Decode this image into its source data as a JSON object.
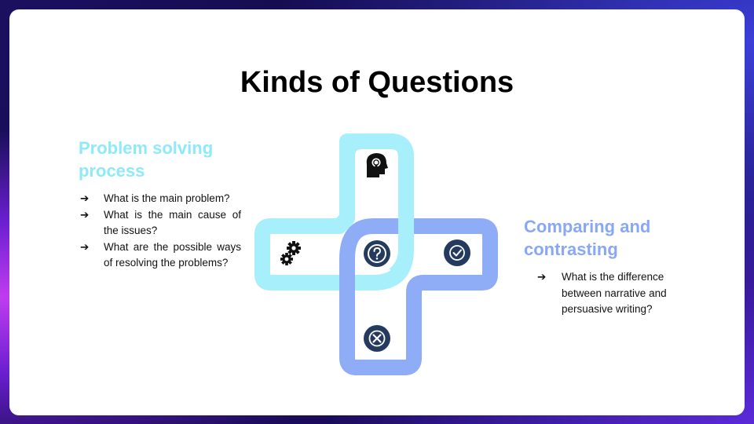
{
  "slide": {
    "title": "Kinds of Questions",
    "left_section": {
      "heading": "Problem solving process",
      "bullets": [
        "What is the main problem?",
        "What is the main cause of the issues?",
        "What are the possible ways of resolving the problems?"
      ]
    },
    "right_section": {
      "heading": "Comparing and contrasting",
      "bullets": [
        "What is the difference between narrative and persuasive writing?"
      ]
    },
    "bullet_arrow": "➔",
    "diagram_icons": [
      "head-lightbulb-icon",
      "gears-icon",
      "question-icon",
      "checkmark-icon",
      "close-x-icon"
    ],
    "colors": {
      "cyan_accent": "#8ee9f8",
      "blue_accent": "#88a8f5",
      "icon_circle": "#243a5e"
    }
  }
}
